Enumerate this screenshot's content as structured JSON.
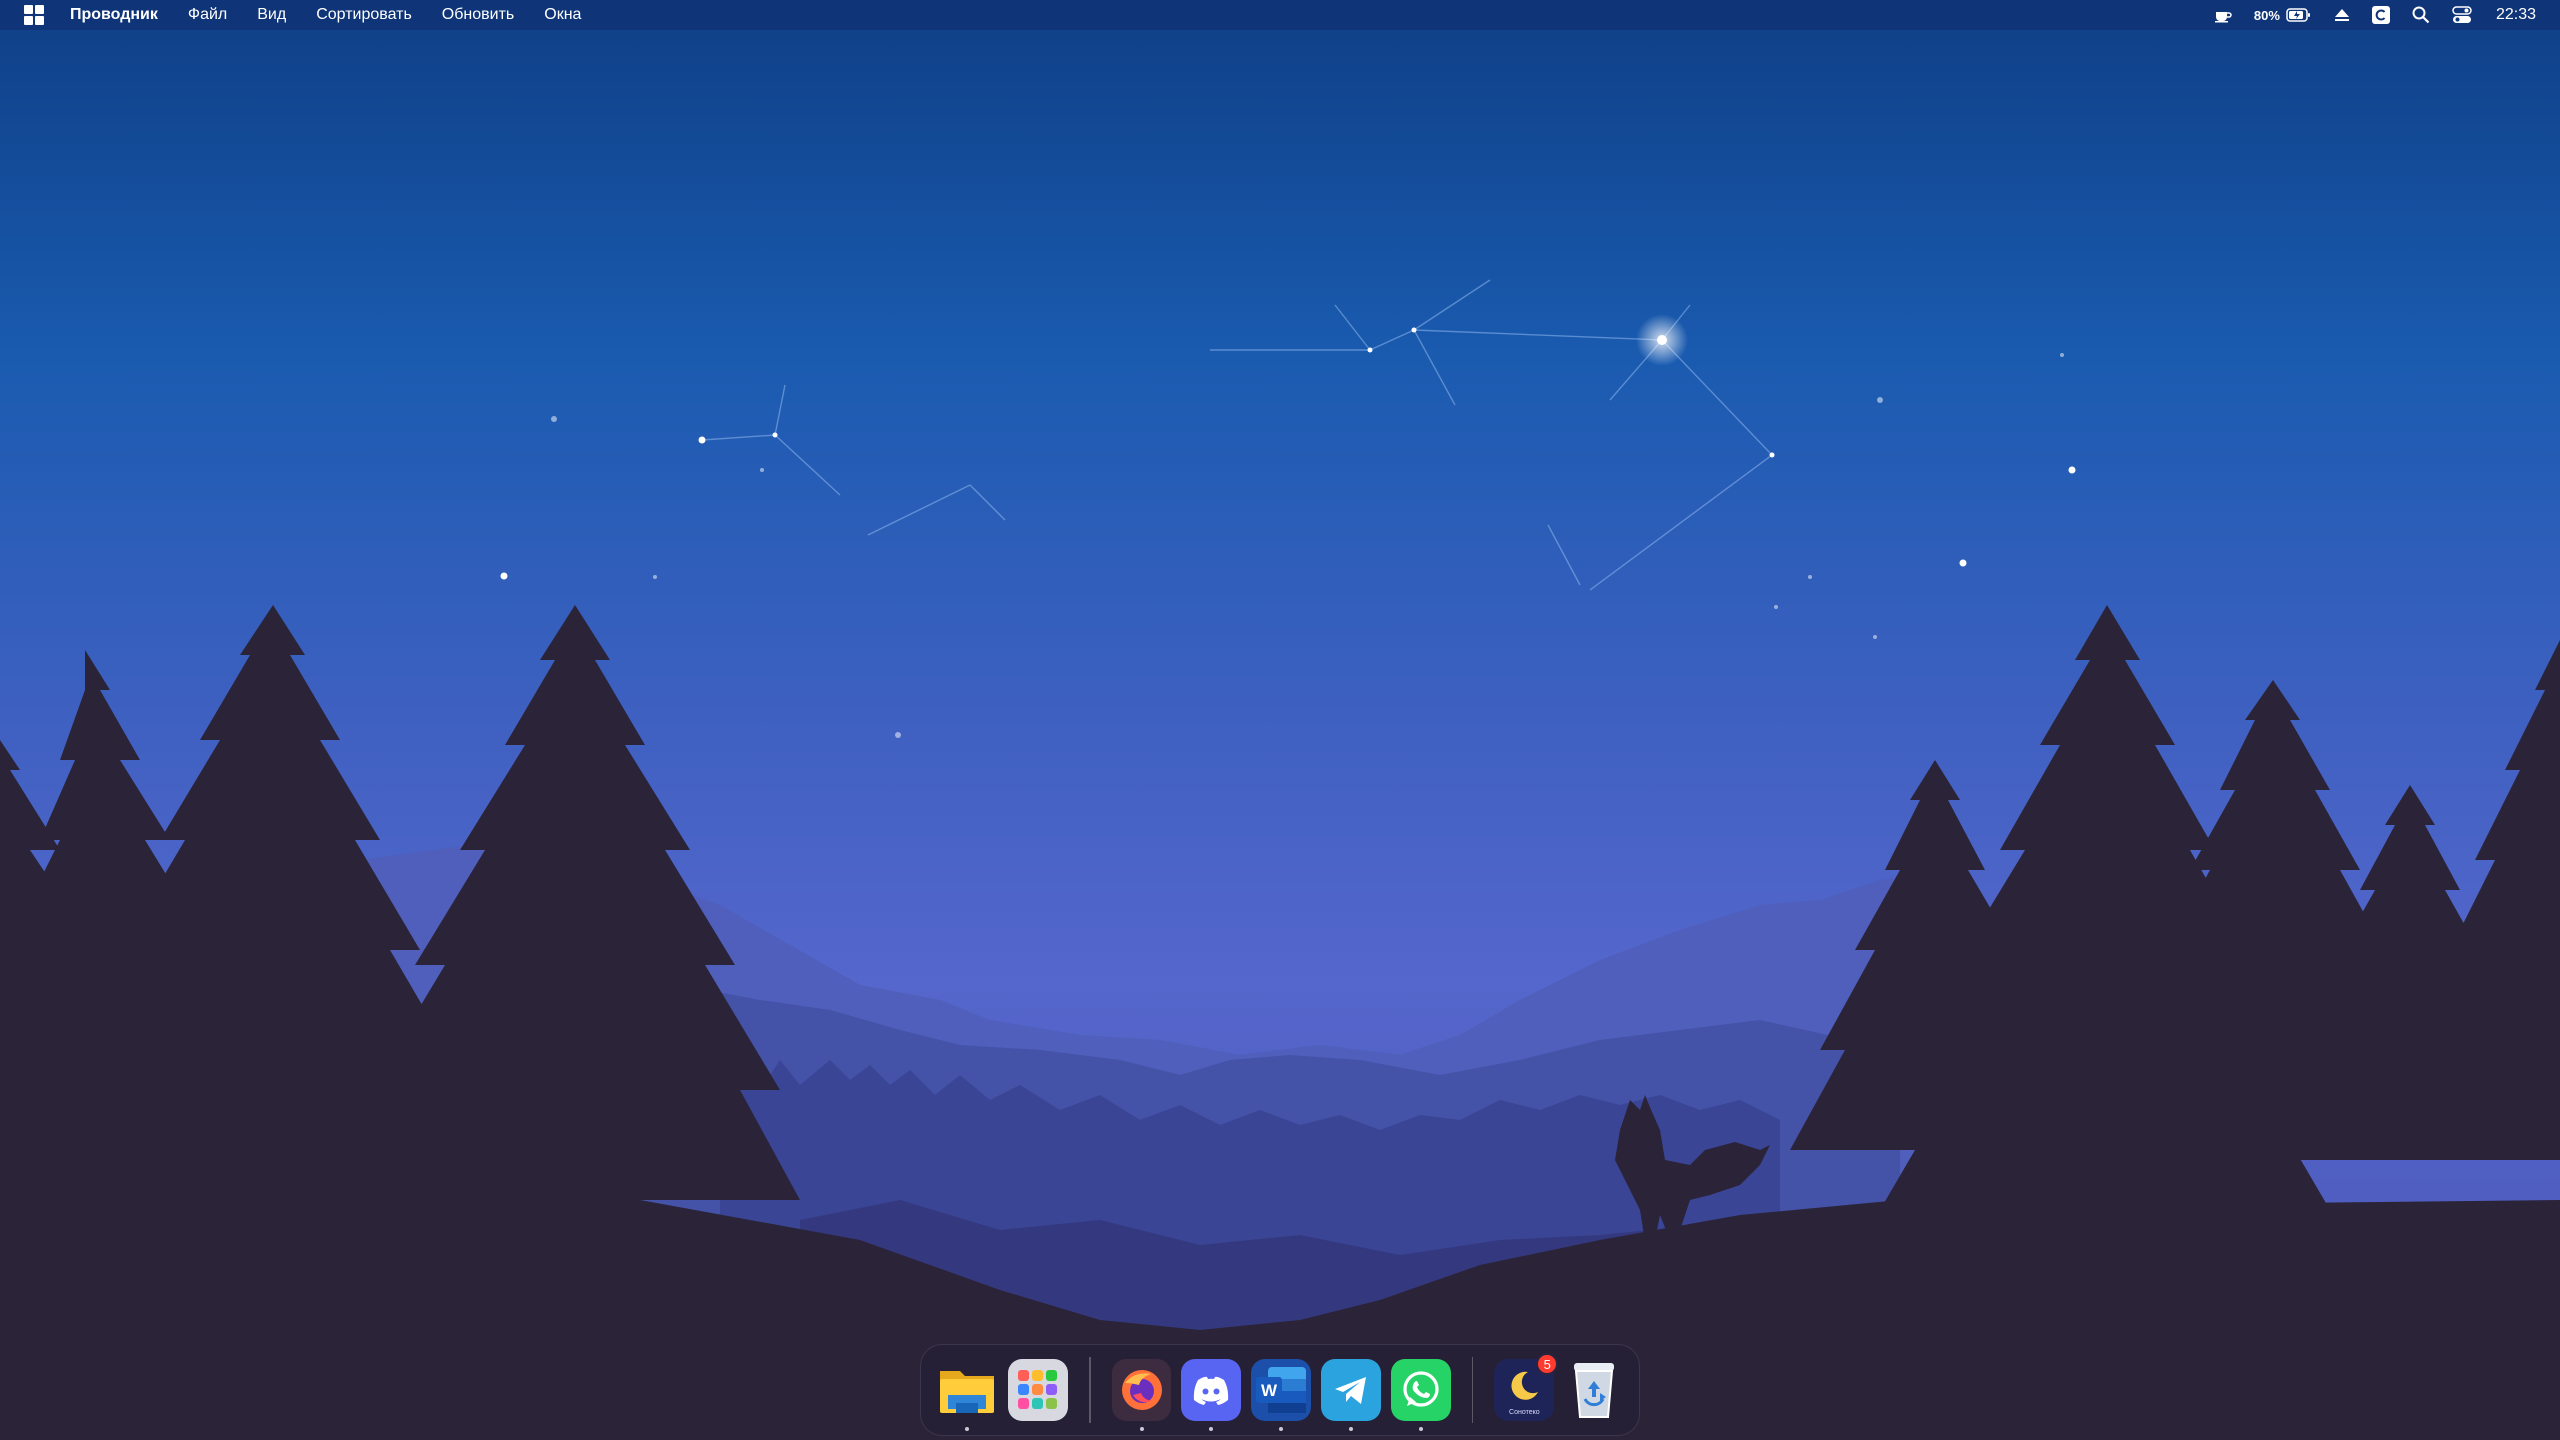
{
  "menubar": {
    "app_name": "Проводник",
    "menus": [
      "Файл",
      "Вид",
      "Сортировать",
      "Обновить",
      "Окна"
    ],
    "tray": {
      "battery_percent": "80%",
      "clock": "22:33"
    }
  },
  "dock": {
    "apps": [
      {
        "name": "file-explorer",
        "icon": "folder-icon",
        "running": true
      },
      {
        "name": "launchpad",
        "icon": "app-grid-icon",
        "running": false
      },
      {
        "name": "firefox",
        "icon": "firefox-icon",
        "running": true
      },
      {
        "name": "discord",
        "icon": "discord-icon",
        "running": true
      },
      {
        "name": "word",
        "icon": "word-icon",
        "running": true
      },
      {
        "name": "telegram",
        "icon": "telegram-icon",
        "running": true
      },
      {
        "name": "whatsapp",
        "icon": "whatsapp-icon",
        "running": true
      },
      {
        "name": "sleep-app",
        "icon": "moon-icon",
        "label": "Сонотеко",
        "badge": "5",
        "running": false
      },
      {
        "name": "recycle-bin",
        "icon": "recycle-bin-icon",
        "running": false
      }
    ]
  },
  "colors": {
    "menubar_bg": "#0f3478",
    "sky_top": "#0f3f86",
    "sky_bottom": "#5566cc",
    "silhouette": "#2b2337"
  }
}
